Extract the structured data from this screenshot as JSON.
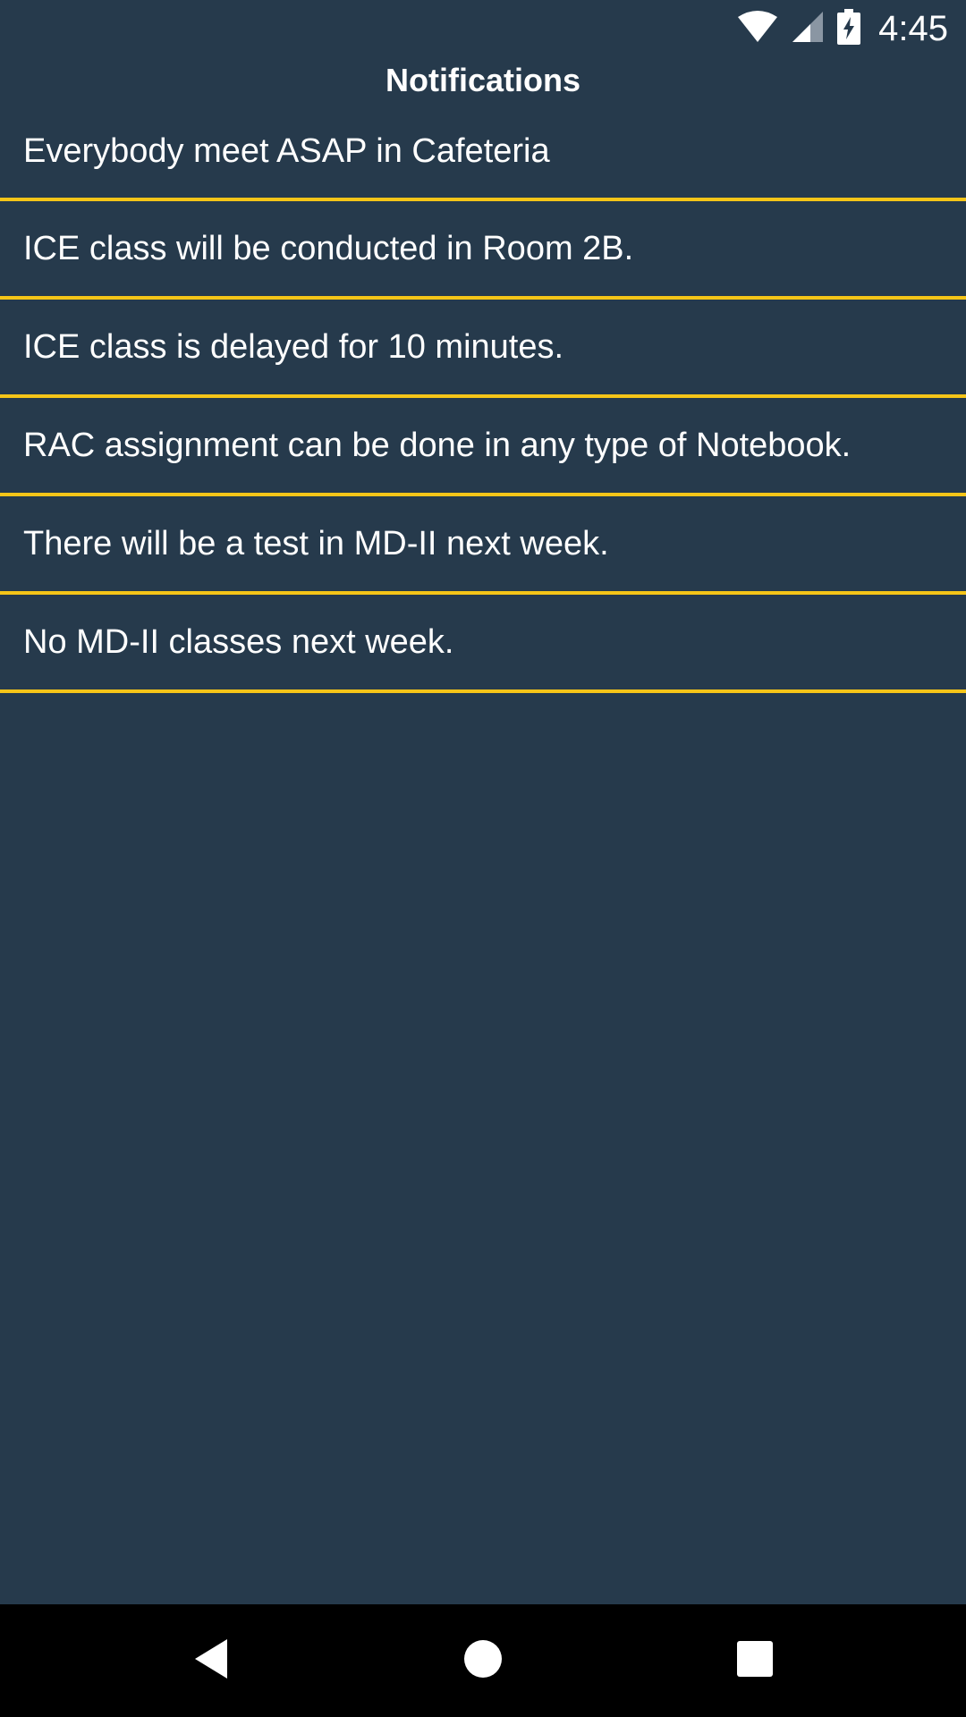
{
  "status_bar": {
    "time": "4:45",
    "icons": [
      "wifi-icon",
      "cellular-signal-icon",
      "battery-charging-icon"
    ]
  },
  "header": {
    "title": "Notifications"
  },
  "notifications": [
    "Everybody meet ASAP in Cafeteria",
    "ICE class will be conducted in Room 2B.",
    "ICE class is delayed for 10 minutes.",
    "RAC assignment can be done in any type of Notebook.",
    "There will be a test in MD-II next week.",
    "No MD-II classes next week."
  ],
  "nav_bar": {
    "buttons": [
      "back-icon",
      "home-icon",
      "recents-icon"
    ]
  },
  "colors": {
    "background": "#263a4c",
    "divider": "#f5c518",
    "nav_background": "#000000",
    "text": "#ffffff"
  }
}
